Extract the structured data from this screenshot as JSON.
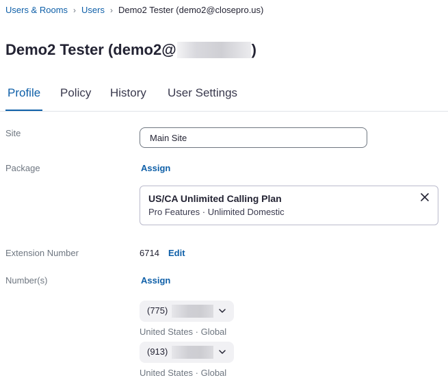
{
  "breadcrumb": {
    "items": [
      "Users & Rooms",
      "Users"
    ],
    "current": "Demo2 Tester (demo2@closepro.us)"
  },
  "page": {
    "title_prefix": "Demo2 Tester (demo2@",
    "title_suffix": ")"
  },
  "tabs": [
    {
      "label": "Profile",
      "active": true
    },
    {
      "label": "Policy",
      "active": false
    },
    {
      "label": "History",
      "active": false
    },
    {
      "label": "User Settings",
      "active": false
    }
  ],
  "profile": {
    "site": {
      "label": "Site",
      "value": "Main Site"
    },
    "package": {
      "label": "Package",
      "assign_label": "Assign",
      "card": {
        "name": "US/CA Unlimited Calling Plan",
        "features": "Pro Features · Unlimited Domestic"
      }
    },
    "extension": {
      "label": "Extension Number",
      "value": "6714",
      "edit_label": "Edit"
    },
    "numbers": {
      "label": "Number(s)",
      "assign_label": "Assign",
      "items": [
        {
          "prefix": "(775)",
          "region": "United States · Global"
        },
        {
          "prefix": "(913)",
          "region": "United States · Global"
        }
      ]
    }
  },
  "colors": {
    "accent": "#0E5FA8",
    "text": "#232333",
    "muted": "#6E7680",
    "border": "#DFE3E8",
    "pill_bg": "#F1F1F4"
  }
}
